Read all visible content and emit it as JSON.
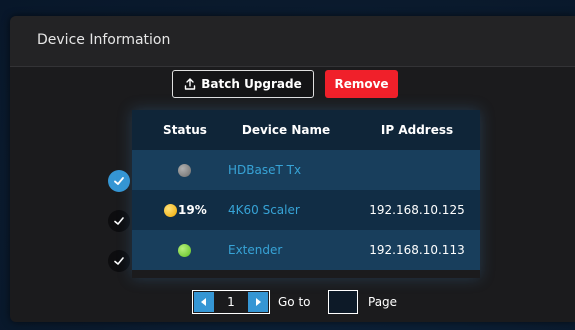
{
  "panel": {
    "title": "Device Information"
  },
  "toolbar": {
    "batch_upgrade_label": "Batch Upgrade",
    "batch_upgrade_icon": "upload-icon",
    "remove_label": "Remove"
  },
  "table": {
    "columns": [
      "Status",
      "Device Name",
      "IP Address"
    ],
    "rows": [
      {
        "selected": true,
        "status": "gray",
        "progress": "",
        "name": "HDBaseT Tx",
        "ip": ""
      },
      {
        "selected": false,
        "status": "yellow",
        "progress": "19%",
        "name": "4K60 Scaler",
        "ip": "192.168.10.125"
      },
      {
        "selected": false,
        "status": "green",
        "progress": "",
        "name": "Extender",
        "ip": "192.168.10.113"
      }
    ]
  },
  "pagination": {
    "current_page": "1",
    "goto_label": "Go to",
    "goto_value": "",
    "page_label": "Page"
  },
  "colors": {
    "accent": "#3596d4",
    "danger": "#f0202a",
    "link": "#37a3d6",
    "status_gray": "#8a8a8a",
    "status_yellow": "#f5c12a",
    "status_green": "#7fd43a"
  }
}
